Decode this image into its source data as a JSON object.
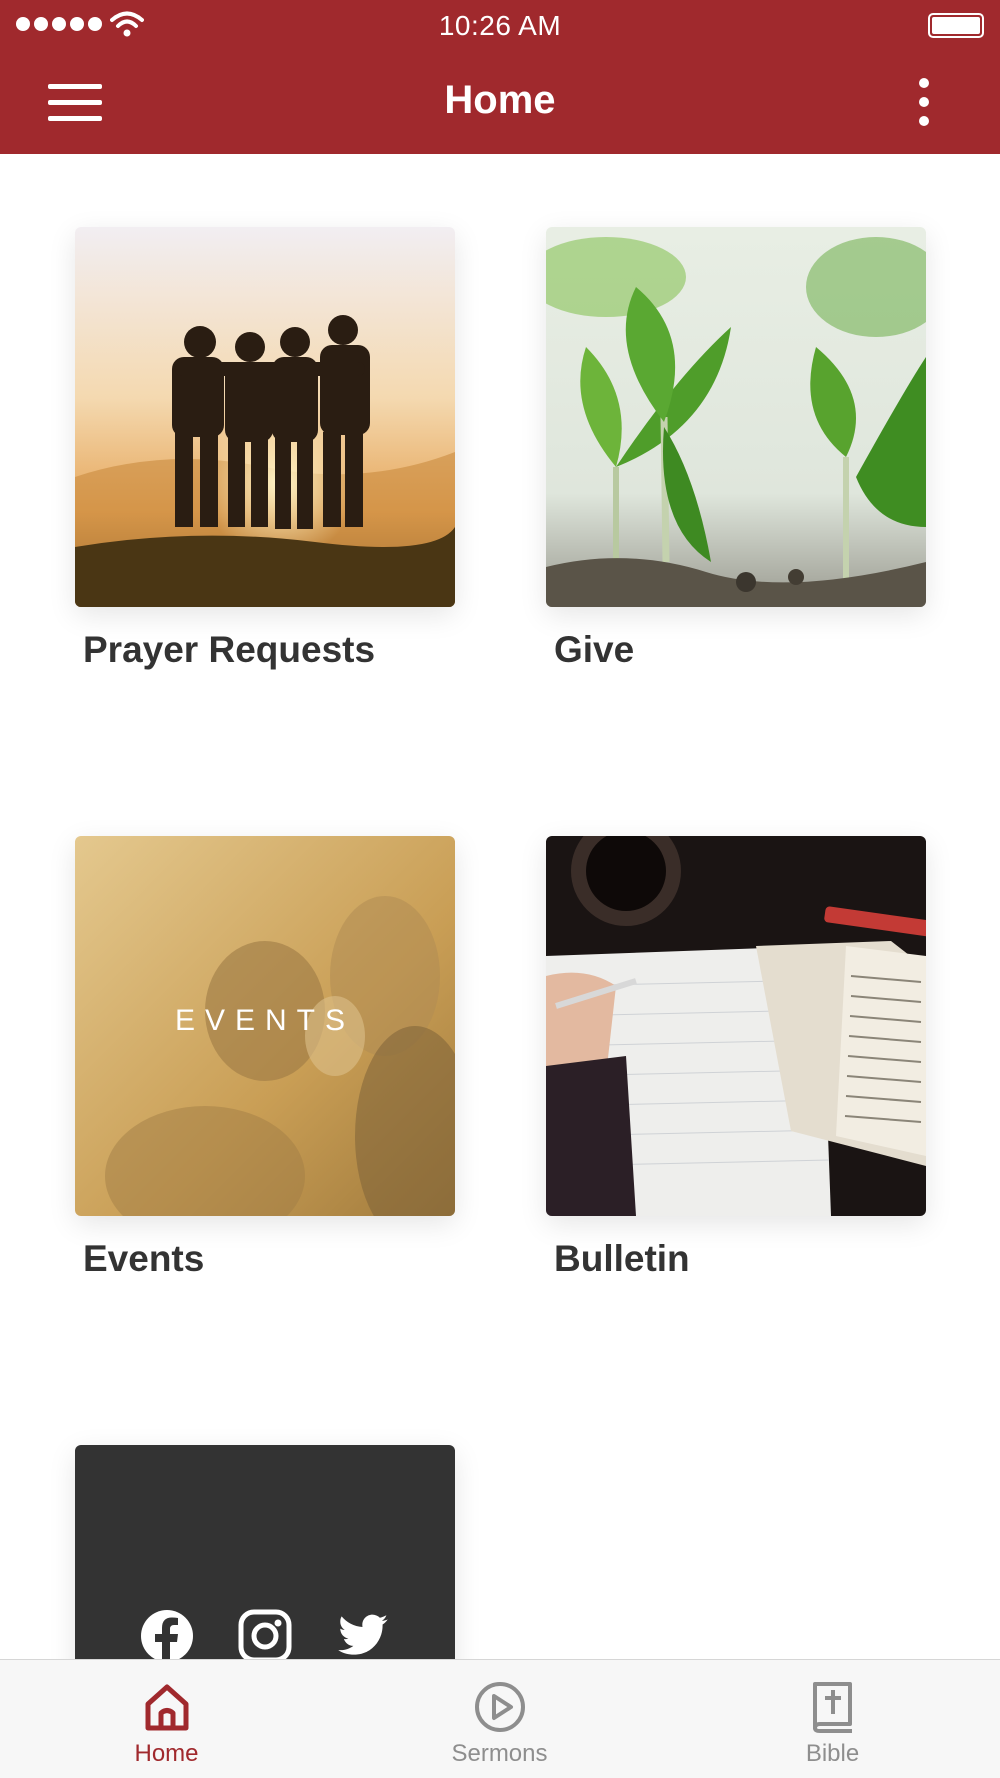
{
  "status_bar": {
    "time": "10:26 AM"
  },
  "header": {
    "title": "Home"
  },
  "tiles": [
    {
      "label": "Prayer Requests",
      "image": "friends-sunset-photo"
    },
    {
      "label": "Give",
      "image": "seedling-sprouts-photo"
    },
    {
      "label": "Events",
      "image": "events-photo",
      "overlay_text": "EVENTS"
    },
    {
      "label": "Bulletin",
      "image": "open-bible-notebook-photo"
    },
    {
      "label": "",
      "image": "social-media-card",
      "icons": [
        "facebook-icon",
        "instagram-icon",
        "twitter-icon"
      ]
    }
  ],
  "tab_bar": {
    "items": [
      {
        "label": "Home",
        "icon": "home-icon",
        "active": true
      },
      {
        "label": "Sermons",
        "icon": "play-circle-icon",
        "active": false
      },
      {
        "label": "Bible",
        "icon": "bible-icon",
        "active": false
      }
    ]
  },
  "colors": {
    "primary": "#a0292d",
    "text": "#333333",
    "tab_inactive": "#8e8e8e",
    "social_card": "#333333"
  }
}
